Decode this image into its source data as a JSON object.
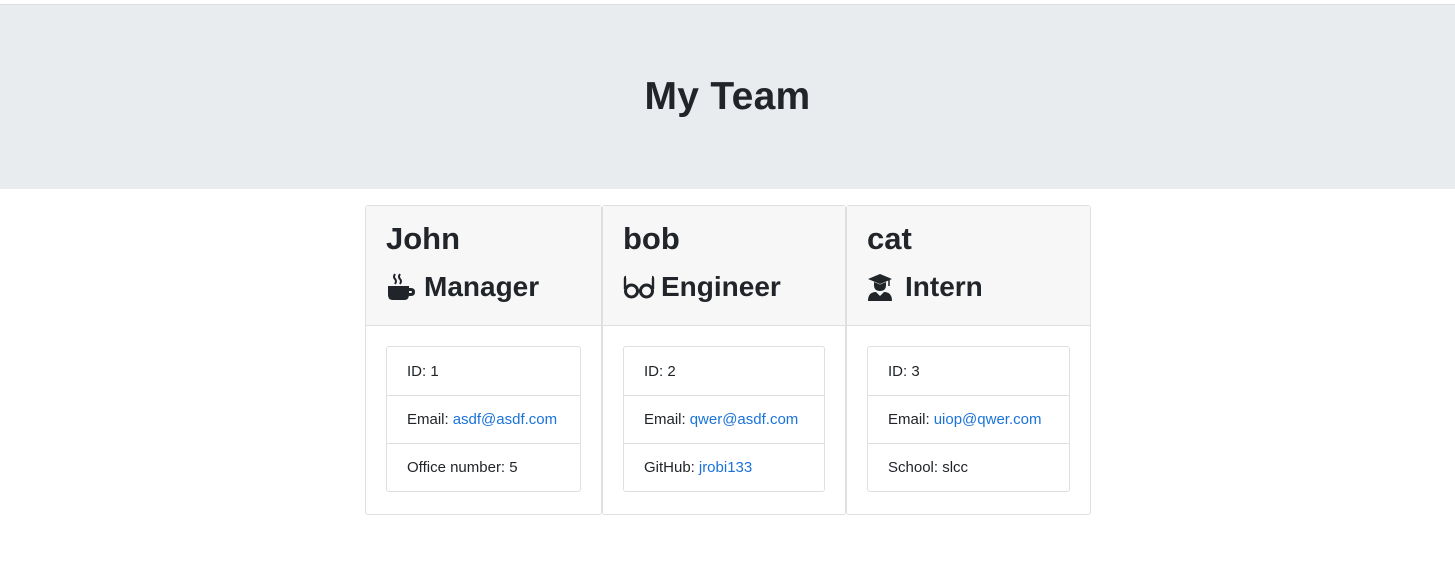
{
  "header": {
    "title": "My Team"
  },
  "team": [
    {
      "name": "John",
      "role": "Manager",
      "icon": "coffee-icon",
      "id_label": "ID: 1",
      "email_label": "Email:",
      "email": "asdf@asdf.com",
      "extra_label": "Office number: 5"
    },
    {
      "name": "bob",
      "role": "Engineer",
      "icon": "glasses-icon",
      "id_label": "ID: 2",
      "email_label": "Email:",
      "email": "qwer@asdf.com",
      "extra_label": "GitHub:",
      "extra_link": "jrobi133"
    },
    {
      "name": "cat",
      "role": "Intern",
      "icon": "graduate-icon",
      "id_label": "ID: 3",
      "email_label": "Email:",
      "email": "uiop@qwer.com",
      "extra_label": "School: slcc"
    }
  ],
  "colors": {
    "link": "#1a73d9",
    "jumbotron": "#e9ecef",
    "card_header": "#f7f7f7"
  }
}
